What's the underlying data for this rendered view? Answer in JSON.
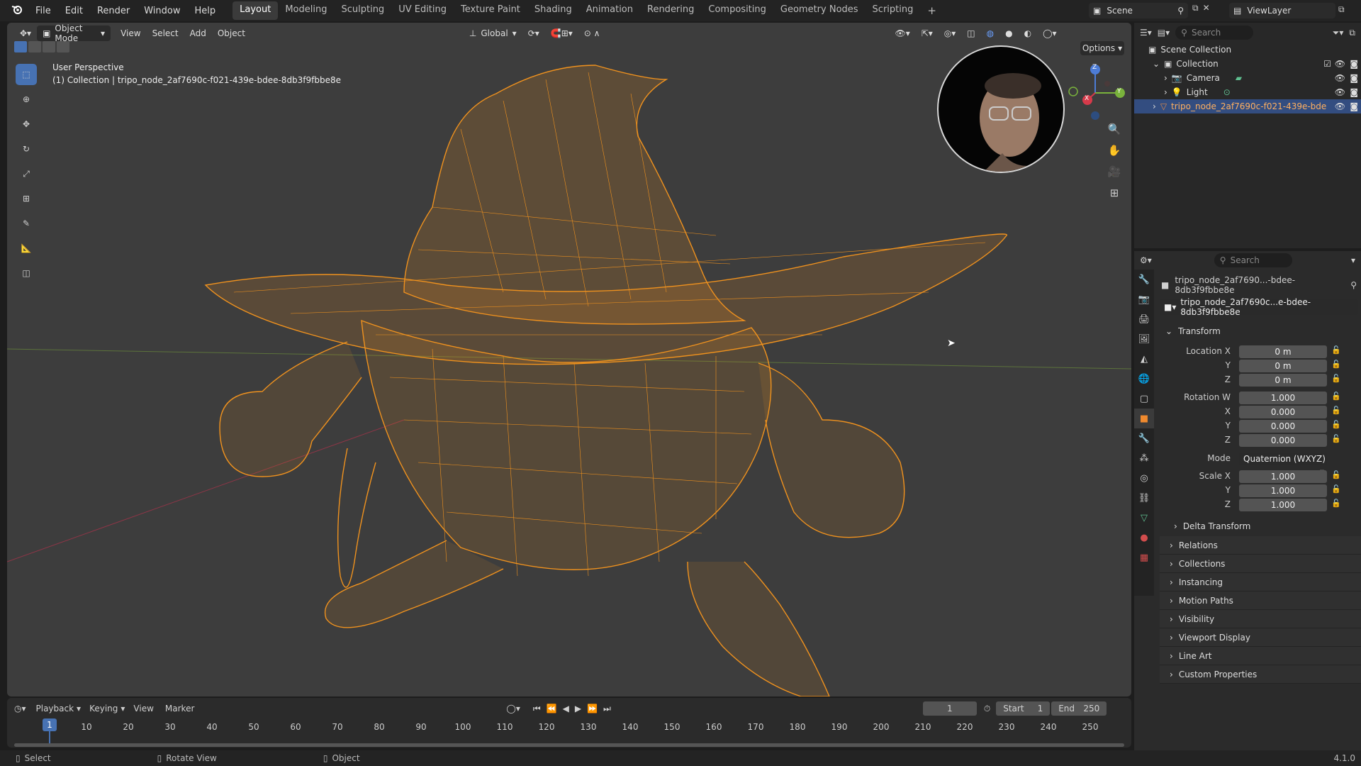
{
  "top_menu": [
    "File",
    "Edit",
    "Render",
    "Window",
    "Help"
  ],
  "workspaces": [
    "Layout",
    "Modeling",
    "Sculpting",
    "UV Editing",
    "Texture Paint",
    "Shading",
    "Animation",
    "Rendering",
    "Compositing",
    "Geometry Nodes",
    "Scripting"
  ],
  "active_workspace": "Layout",
  "scene_name": "Scene",
  "view_layer": "ViewLayer",
  "viewport": {
    "mode": "Object Mode",
    "menus": [
      "View",
      "Select",
      "Add",
      "Object"
    ],
    "orientation": "Global",
    "options_label": "Options",
    "perspective_label": "User Perspective",
    "collection_label": "(1) Collection | tripo_node_2af7690c-f021-439e-bdee-8db3f9fbbe8e",
    "gizmo_axes": {
      "z": "Z",
      "y": "Y",
      "x": "X"
    }
  },
  "outliner": {
    "search_placeholder": "Search",
    "scene_collection": "Scene Collection",
    "collection": "Collection",
    "camera": "Camera",
    "light": "Light",
    "object": "tripo_node_2af7690c-f021-439e-bde"
  },
  "properties": {
    "search_placeholder": "Search",
    "object_name_short": "tripo_node_2af7690...-bdee-8db3f9fbbe8e",
    "object_name_field": "tripo_node_2af7690c...e-bdee-8db3f9fbbe8e",
    "transform_title": "Transform",
    "location_label": "Location X",
    "location": {
      "x": "0 m",
      "y": "0 m",
      "z": "0 m"
    },
    "rotation_label": "Rotation W",
    "rotation": {
      "w": "1.000",
      "x": "0.000",
      "y": "0.000",
      "z": "0.000"
    },
    "mode_label": "Mode",
    "mode_value": "Quaternion (WXYZ)",
    "scale_label": "Scale X",
    "scale": {
      "x": "1.000",
      "y": "1.000",
      "z": "1.000"
    },
    "axis_y": "Y",
    "axis_z": "Z",
    "axis_x": "X",
    "delta_transform": "Delta Transform",
    "panels": [
      "Relations",
      "Collections",
      "Instancing",
      "Motion Paths",
      "Visibility",
      "Viewport Display",
      "Line Art",
      "Custom Properties"
    ]
  },
  "timeline": {
    "menus": [
      "Playback",
      "Keying",
      "View",
      "Marker"
    ],
    "current_frame": "1",
    "start_label": "Start",
    "start_value": "1",
    "end_label": "End",
    "end_value": "250",
    "ticks": [
      "10",
      "20",
      "30",
      "40",
      "50",
      "60",
      "70",
      "80",
      "90",
      "100",
      "110",
      "120",
      "130",
      "140",
      "150",
      "160",
      "170",
      "180",
      "190",
      "200",
      "210",
      "220",
      "230",
      "240",
      "250"
    ],
    "playhead": "1"
  },
  "statusbar": {
    "select": "Select",
    "rotate": "Rotate View",
    "object": "Object",
    "version": "4.1.0"
  },
  "colors": {
    "wireframe": "#f0921e",
    "selected": "#4772b3",
    "viewport_bg": "#3d3d3d"
  }
}
